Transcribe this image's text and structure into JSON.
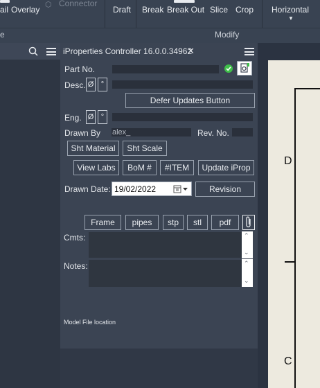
{
  "ribbon": {
    "items": [
      "ail",
      "Overlay",
      "Connector",
      "Draft",
      "Break",
      "Break Out",
      "Slice",
      "Crop",
      "Horizontal"
    ],
    "group_left": "e",
    "group_modify": "Modify"
  },
  "panel": {
    "title": "iProperties Controller 16.0.0.34962",
    "close": "✕",
    "part_no_label": "Part No.",
    "desc_label": "Desc.",
    "diameter_symbol": "Ø",
    "degree_symbol": "°",
    "defer_button": "Defer Updates Button",
    "eng_label": "Eng.",
    "drawn_by_label": "Drawn By",
    "drawn_by_value": "alex_",
    "rev_no_label": "Rev. No.",
    "sht_material": "Sht Material",
    "sht_scale": "Sht Scale",
    "view_labs": "View Labs",
    "bom": "BoM #",
    "item": "#ITEM",
    "update_iprop": "Update iProp",
    "drawn_date_label": "Drawn Date:",
    "drawn_date_value": "19/02/2022",
    "revision": "Revision",
    "frame": "Frame",
    "pipes": "pipes",
    "stp": "stp",
    "stl": "stl",
    "pdf": "pdf",
    "cmts_label": "Cmts:",
    "notes_label": "Notes:",
    "model_file_location": "Model File location"
  },
  "sheet": {
    "label_d": "D",
    "label_c": "C"
  },
  "colors": {
    "ok_check": "#3fbf4a"
  }
}
